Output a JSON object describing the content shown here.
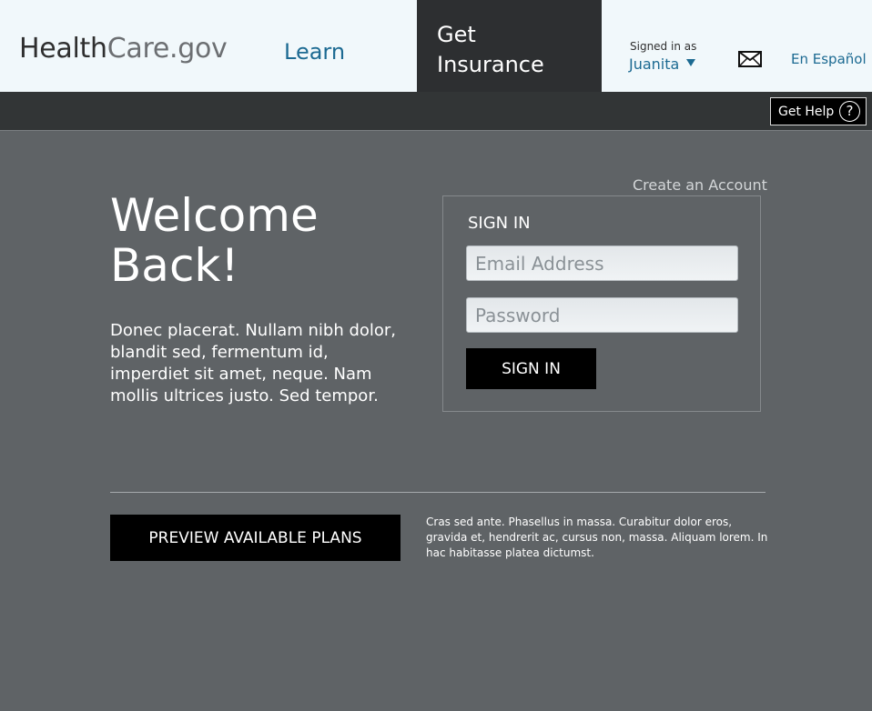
{
  "header": {
    "logo_part1": "Health",
    "logo_part2": "Care.gov",
    "nav_learn": "Learn",
    "nav_get_insurance": "Get Insurance",
    "signed_in_label": "Signed in as",
    "user_name": "Juanita",
    "mail_icon": "envelope-icon",
    "language_link": "En Español"
  },
  "subbar": {
    "get_help_label": "Get Help",
    "help_icon": "question-circle-icon"
  },
  "main": {
    "welcome_title": "Welcome Back!",
    "intro_text": "Donec placerat. Nullam nibh dolor, blandit sed, fermentum id, imperdiet sit amet, neque. Nam mollis ultrices justo. Sed tempor."
  },
  "signin": {
    "create_account_link": "Create an Account",
    "title": "SIGN IN",
    "email_placeholder": "Email Address",
    "password_placeholder": "Password",
    "submit_label": "SIGN IN"
  },
  "footer": {
    "preview_button": "PREVIEW AVAILABLE PLANS",
    "note": "Cras sed ante. Phasellus in massa. Curabitur dolor eros, gravida et, hendrerit ac, cursus non, massa. Aliquam lorem. In hac habitasse platea dictumst."
  },
  "colors": {
    "page_background": "#5f6366",
    "topbar_background": "#f1f8fb",
    "active_nav_background": "#2d2f31",
    "link_blue": "#1c6a92",
    "button_black": "#000000"
  }
}
